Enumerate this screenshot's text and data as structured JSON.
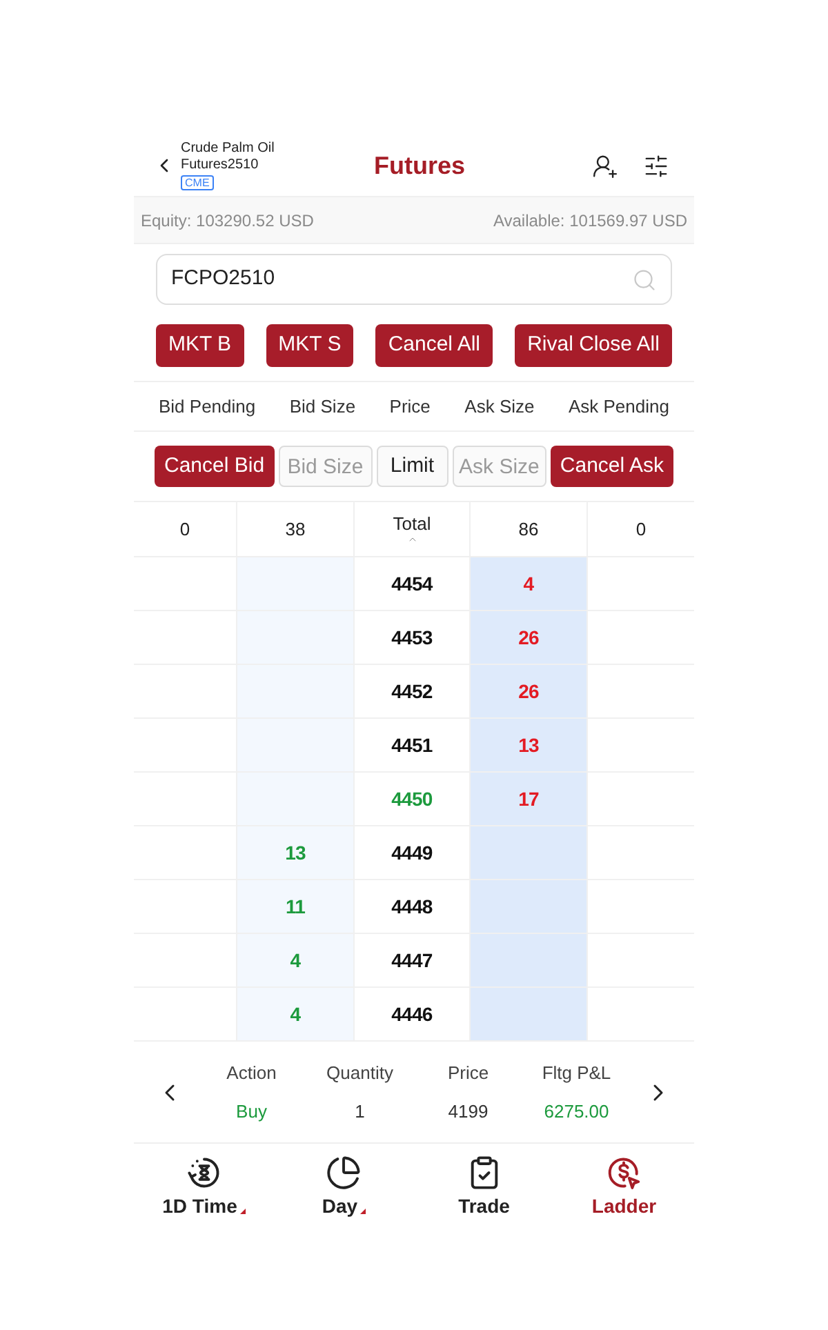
{
  "header": {
    "instrument": "Crude Palm Oil Futures2510",
    "exchange": "CME",
    "title": "Futures"
  },
  "account": {
    "equity": "Equity: 103290.52 USD",
    "available": "Available: 101569.97 USD"
  },
  "search": {
    "value": "FCPO2510"
  },
  "quick_actions": [
    "MKT B",
    "MKT S",
    "Cancel All",
    "Rival Close All"
  ],
  "columns": [
    "Bid Pending",
    "Bid Size",
    "Price",
    "Ask Size",
    "Ask Pending"
  ],
  "order_controls": [
    {
      "kind": "button",
      "label": "Cancel Bid"
    },
    {
      "kind": "input",
      "placeholder": "Bid Size"
    },
    {
      "kind": "option",
      "label": "Limit"
    },
    {
      "kind": "input",
      "placeholder": "Ask Size"
    },
    {
      "kind": "button",
      "label": "Cancel Ask"
    }
  ],
  "totals": {
    "bid_pending": "0",
    "bid_size": "38",
    "label": "Total",
    "ask_size": "86",
    "ask_pending": "0"
  },
  "ladder": [
    {
      "price": "4454",
      "ask_size": "4",
      "last": false
    },
    {
      "price": "4453",
      "ask_size": "26",
      "last": false
    },
    {
      "price": "4452",
      "ask_size": "26",
      "last": false
    },
    {
      "price": "4451",
      "ask_size": "13",
      "last": false
    },
    {
      "price": "4450",
      "ask_size": "17",
      "last": true
    },
    {
      "price": "4449",
      "bid_size": "13",
      "last": false
    },
    {
      "price": "4448",
      "bid_size": "11",
      "last": false
    },
    {
      "price": "4447",
      "bid_size": "4",
      "last": false
    },
    {
      "price": "4446",
      "bid_size": "4",
      "last": false
    }
  ],
  "positions": {
    "columns": [
      "Action",
      "Quantity",
      "Price",
      "Fltg P&L"
    ],
    "rows": [
      {
        "cells": [
          {
            "text": "Buy",
            "color": "#1c9a3d"
          },
          {
            "text": "1",
            "color": "#333333"
          },
          {
            "text": "4199",
            "color": "#333333"
          },
          {
            "text": "6275.00",
            "color": "#1c9a3d"
          }
        ]
      }
    ]
  },
  "tabs": [
    {
      "kind": "timer",
      "label": "1D Time",
      "dropdown": true,
      "selected": false
    },
    {
      "kind": "pie",
      "label": "Day",
      "dropdown": true,
      "selected": false
    },
    {
      "kind": "clipboard",
      "label": "Trade",
      "dropdown": false,
      "selected": false
    },
    {
      "kind": "ladder",
      "label": "Ladder",
      "dropdown": false,
      "selected": true
    }
  ]
}
